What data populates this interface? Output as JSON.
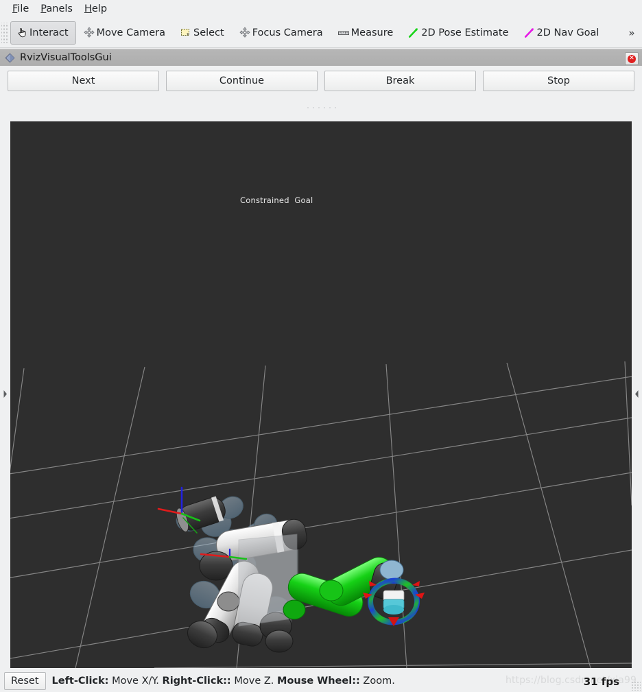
{
  "window": {
    "panel_title": "RvizVisualToolsGui"
  },
  "menubar": {
    "items": [
      {
        "label": "File",
        "mnemonic": "F",
        "rest": "ile"
      },
      {
        "label": "Panels",
        "mnemonic": "P",
        "rest": "anels"
      },
      {
        "label": "Help",
        "mnemonic": "H",
        "rest": "elp"
      }
    ]
  },
  "toolbar": {
    "items": [
      {
        "label": "Interact",
        "icon": "hand-cursor-icon",
        "checked": true
      },
      {
        "label": "Move Camera",
        "icon": "move-camera-icon",
        "checked": false
      },
      {
        "label": "Select",
        "icon": "select-box-icon",
        "checked": false
      },
      {
        "label": "Focus Camera",
        "icon": "focus-camera-icon",
        "checked": false
      },
      {
        "label": "Measure",
        "icon": "ruler-icon",
        "checked": false
      },
      {
        "label": "2D Pose Estimate",
        "icon": "green-arrow-icon",
        "checked": false
      },
      {
        "label": "2D Nav Goal",
        "icon": "magenta-arrow-icon",
        "checked": false
      }
    ],
    "overflow_label": "»"
  },
  "panel": {
    "title_icon": "diamond-icon",
    "close_icon": "close-icon",
    "close_glyph": "✕",
    "buttons": [
      {
        "label": "Next"
      },
      {
        "label": "Continue"
      },
      {
        "label": "Break"
      },
      {
        "label": "Stop"
      }
    ]
  },
  "viewport": {
    "background_color": "#2e2e2e",
    "grid_color": "#a9a9a9",
    "marker_label": "Constrained  Goal",
    "left_handle_icon": "chevron-right-icon",
    "right_handle_icon": "chevron-left-icon",
    "robot": {
      "current_state_color": "#c6c6c6",
      "goal_state_color": "#1fd61f",
      "ghost_state_color": "#8fb6d1",
      "interactive_marker_ring_colors": [
        "#1fc11f",
        "#1a33cc"
      ],
      "axis_colors": {
        "x": "#e01b1b",
        "y": "#18c018",
        "z": "#2222dd"
      }
    }
  },
  "statusbar": {
    "reset_label": "Reset",
    "hints": [
      {
        "bold": "Left-Click:",
        "text": " Move X/Y. "
      },
      {
        "bold": "Right-Click::",
        "text": " Move Z. "
      },
      {
        "bold": "Mouse Wheel::",
        "text": " Zoom."
      }
    ],
    "fps": "31 fps",
    "watermark": "https://blog.csdn.net/xia99"
  }
}
